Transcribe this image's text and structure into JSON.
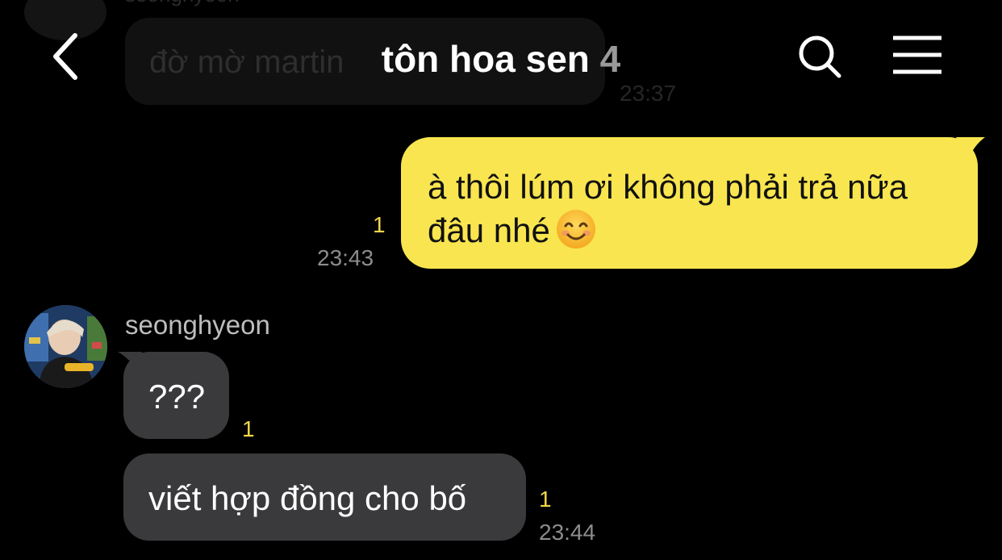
{
  "background_message": {
    "sender": "seonghyeon",
    "text": "đờ mờ martin",
    "time": "23:37"
  },
  "header": {
    "title": "tôn hoa sen",
    "member_count": "4",
    "back_icon": "chevron-left-icon",
    "search_icon": "search-icon",
    "menu_icon": "hamburger-menu-icon"
  },
  "messages": {
    "mine": {
      "line1": "à thôi lúm ơi không phải trả nữa",
      "line2": "đâu nhé",
      "emoji": "smiling-face-icon",
      "unread": "1",
      "time": "23:43",
      "bubble_color": "#f9e54f"
    },
    "theirs": {
      "sender": "seonghyeon",
      "first": {
        "text": "???",
        "unread": "1"
      },
      "second": {
        "text": "viết hợp đồng cho bố",
        "unread": "1",
        "time": "23:44"
      },
      "bubble_color": "#3a3a3c"
    }
  },
  "colors": {
    "background": "#000000",
    "unread_accent": "#f2d749",
    "time_text": "#8c8c8c"
  }
}
